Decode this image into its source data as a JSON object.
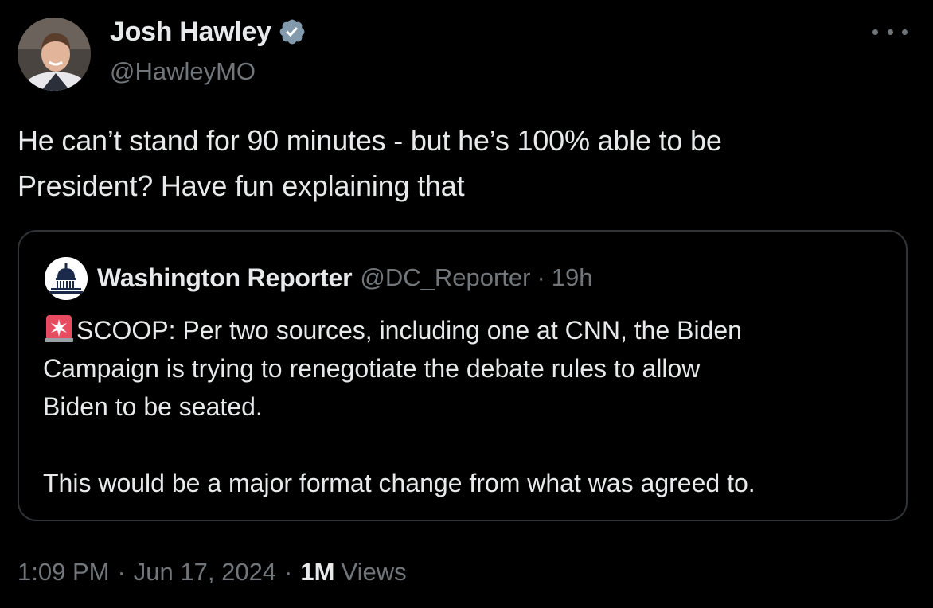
{
  "author": {
    "name": "Josh Hawley",
    "handle": "@HawleyMO",
    "verified": true
  },
  "tweet": {
    "text_line1": "He can’t stand for 90 minutes - but he’s 100% able to be",
    "text_line2": "President? Have fun explaining that"
  },
  "quote": {
    "name": "Washington Reporter",
    "handle": "@DC_Reporter",
    "separator": "·",
    "time": "19h",
    "icon": "capitol-dome-icon",
    "siren_icon": "police-siren-icon",
    "line1": "SCOOP: Per two sources, including one at CNN, the Biden",
    "line2": "Campaign is trying to renegotiate the debate rules to allow",
    "line3": "Biden to be seated.",
    "line4": "This would be a major format change from what was agreed to."
  },
  "meta": {
    "time": "1:09 PM",
    "sep1": "·",
    "date": "Jun 17, 2024",
    "sep2": "·",
    "views_count": "1M",
    "views_label": "Views"
  },
  "colors": {
    "background": "#000000",
    "text": "#e7e9ea",
    "secondary": "#71767b",
    "border": "#2f3336",
    "verified": "#829aab"
  }
}
